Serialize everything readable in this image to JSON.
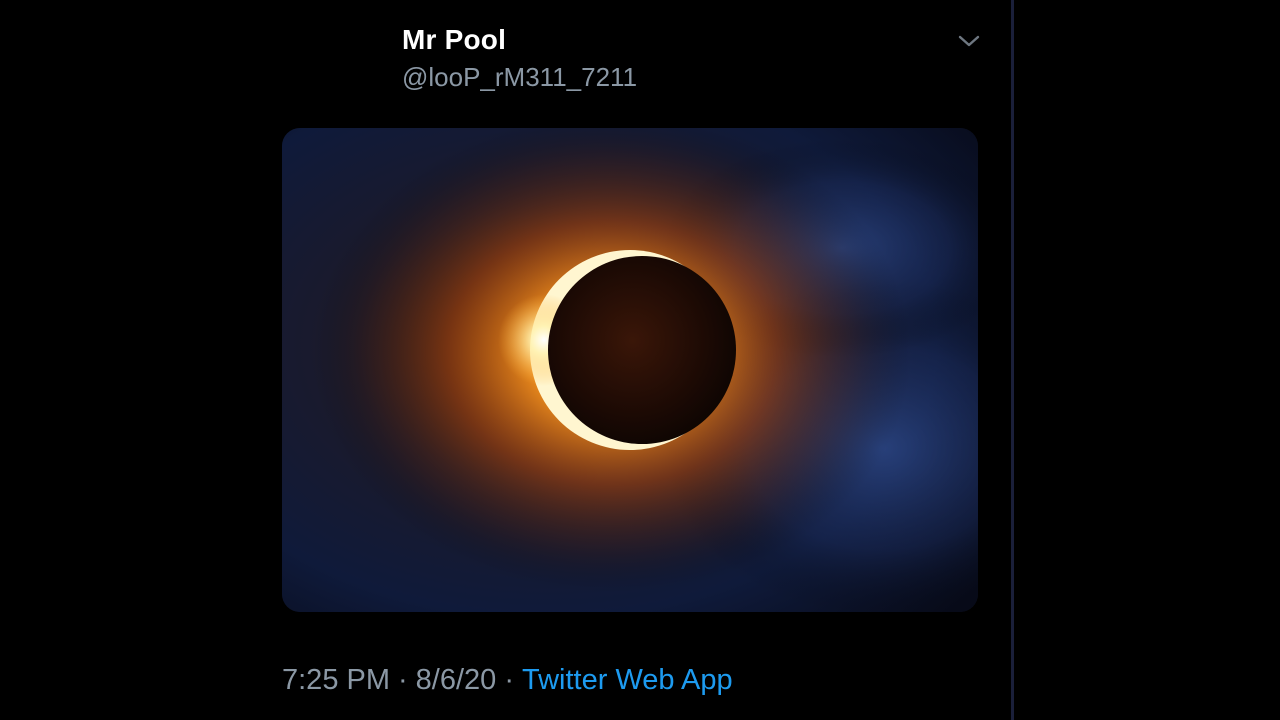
{
  "tweet": {
    "display_name": "Mr Pool",
    "handle": "@looP_rM311_7211",
    "menu_icon": "chevron-down-icon",
    "media": {
      "subject": "solar-eclipse-image"
    },
    "time": "7:25 PM",
    "separator": "·",
    "date": "8/6/20",
    "source": "Twitter Web App"
  },
  "colors": {
    "background": "#000000",
    "name": "#ffffff",
    "secondary_text": "#8b98a5",
    "link": "#1d9bf0",
    "column_border": "#1a1f3a"
  }
}
